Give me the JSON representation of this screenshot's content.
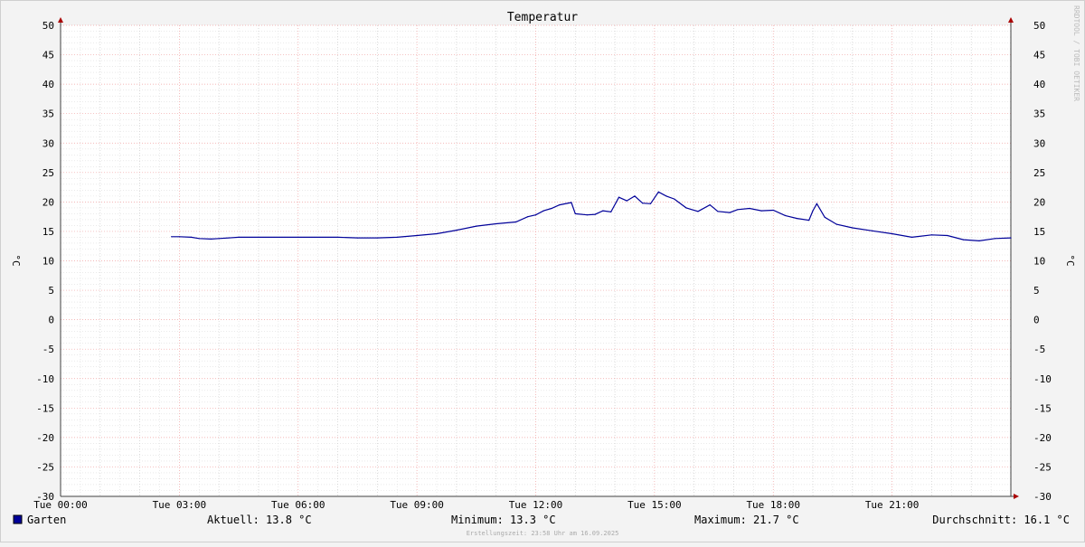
{
  "chart_data": {
    "type": "line",
    "title": "Temperatur",
    "ylabel": "°C",
    "ylabel_right": "°C",
    "ylim": [
      -30,
      50
    ],
    "y_ticks": [
      50,
      45,
      40,
      35,
      30,
      25,
      20,
      15,
      10,
      5,
      0,
      -5,
      -10,
      -15,
      -20,
      -25,
      -30
    ],
    "x_range_hours": [
      0,
      24
    ],
    "x_ticks": [
      {
        "hour": 0,
        "label": "Tue 00:00"
      },
      {
        "hour": 3,
        "label": "Tue 03:00"
      },
      {
        "hour": 6,
        "label": "Tue 06:00"
      },
      {
        "hour": 9,
        "label": "Tue 09:00"
      },
      {
        "hour": 12,
        "label": "Tue 12:00"
      },
      {
        "hour": 15,
        "label": "Tue 15:00"
      },
      {
        "hour": 18,
        "label": "Tue 18:00"
      },
      {
        "hour": 21,
        "label": "Tue 21:00"
      }
    ],
    "grid": true,
    "legend_position": "bottom-left",
    "series": [
      {
        "name": "Garten",
        "color": "#000099",
        "points": [
          [
            2.8,
            14.1
          ],
          [
            3.0,
            14.1
          ],
          [
            3.3,
            14.0
          ],
          [
            3.5,
            13.8
          ],
          [
            3.8,
            13.7
          ],
          [
            4.0,
            13.8
          ],
          [
            4.5,
            14.0
          ],
          [
            5.0,
            14.0
          ],
          [
            6.0,
            14.0
          ],
          [
            7.0,
            14.0
          ],
          [
            7.5,
            13.9
          ],
          [
            8.0,
            13.9
          ],
          [
            8.5,
            14.0
          ],
          [
            9.0,
            14.3
          ],
          [
            9.5,
            14.6
          ],
          [
            10.0,
            15.2
          ],
          [
            10.5,
            15.9
          ],
          [
            11.0,
            16.3
          ],
          [
            11.5,
            16.6
          ],
          [
            11.8,
            17.5
          ],
          [
            12.0,
            17.8
          ],
          [
            12.2,
            18.5
          ],
          [
            12.4,
            18.9
          ],
          [
            12.6,
            19.5
          ],
          [
            12.9,
            19.9
          ],
          [
            13.0,
            18.0
          ],
          [
            13.3,
            17.8
          ],
          [
            13.5,
            17.9
          ],
          [
            13.7,
            18.5
          ],
          [
            13.9,
            18.3
          ],
          [
            14.1,
            20.8
          ],
          [
            14.3,
            20.2
          ],
          [
            14.5,
            21.0
          ],
          [
            14.7,
            19.8
          ],
          [
            14.9,
            19.7
          ],
          [
            15.1,
            21.7
          ],
          [
            15.3,
            21.0
          ],
          [
            15.5,
            20.5
          ],
          [
            15.8,
            19.0
          ],
          [
            16.1,
            18.4
          ],
          [
            16.4,
            19.5
          ],
          [
            16.6,
            18.4
          ],
          [
            16.9,
            18.2
          ],
          [
            17.1,
            18.7
          ],
          [
            17.4,
            18.9
          ],
          [
            17.7,
            18.5
          ],
          [
            18.0,
            18.6
          ],
          [
            18.3,
            17.7
          ],
          [
            18.6,
            17.2
          ],
          [
            18.9,
            16.9
          ],
          [
            19.0,
            18.5
          ],
          [
            19.1,
            19.7
          ],
          [
            19.3,
            17.4
          ],
          [
            19.6,
            16.2
          ],
          [
            20.0,
            15.6
          ],
          [
            20.5,
            15.1
          ],
          [
            21.0,
            14.6
          ],
          [
            21.5,
            14.0
          ],
          [
            22.0,
            14.4
          ],
          [
            22.4,
            14.3
          ],
          [
            22.8,
            13.6
          ],
          [
            23.2,
            13.4
          ],
          [
            23.6,
            13.8
          ],
          [
            24.0,
            13.9
          ]
        ]
      }
    ]
  },
  "legend": {
    "series_name": "Garten",
    "series_color": "#000099",
    "current": "Aktuell: 13.8 °C",
    "minimum": "Minimum: 13.3 °C",
    "maximum": "Maximum: 21.7 °C",
    "average": "Durchschnitt: 16.1 °C"
  },
  "footer": {
    "created": "Erstellungszeit: 23:58 Uhr am 16.09.2025"
  },
  "watermark": "RRDTOOL / TOBI OETIKER"
}
